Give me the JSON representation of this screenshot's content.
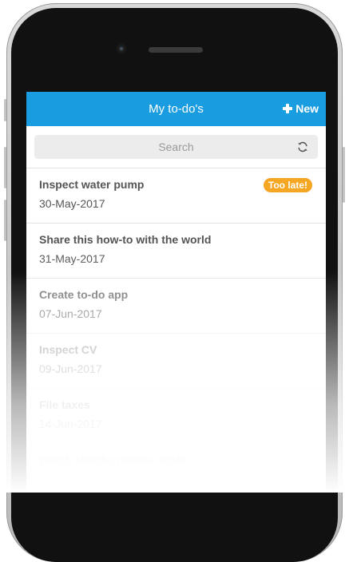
{
  "header": {
    "title": "My to-do's",
    "new_label": "New",
    "color": "#1a9ce0"
  },
  "search": {
    "placeholder": "Search"
  },
  "icons": {
    "new": "plus-icon",
    "refresh": "refresh-icon"
  },
  "todos": [
    {
      "title": "Inspect water pump",
      "date": "30-May-2017",
      "badge": "Too late!",
      "badge_color": "#f5a623"
    },
    {
      "title": "Share this how-to with the world",
      "date": "31-May-2017"
    },
    {
      "title": "Create to-do app",
      "date": "07-Jun-2017"
    },
    {
      "title": "Inspect CV",
      "date": "09-Jun-2017"
    },
    {
      "title": "File taxes",
      "date": "14-Jun-2017"
    },
    {
      "title": "Watch Mendix release video",
      "date": "15-Jun-2017"
    }
  ]
}
